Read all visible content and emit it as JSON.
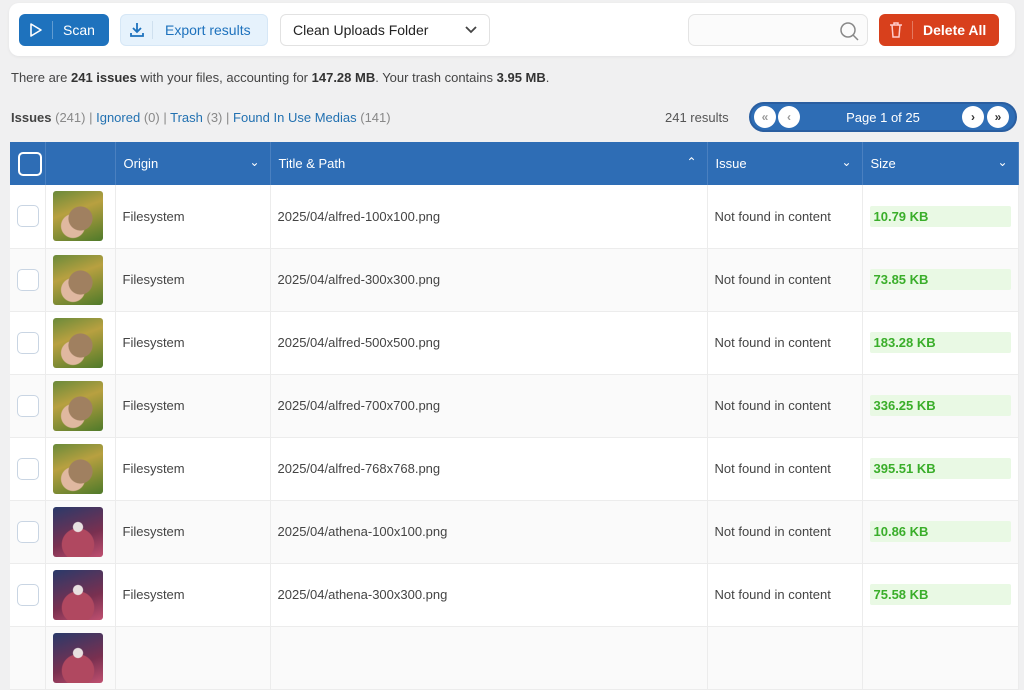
{
  "toolbar": {
    "scan": "Scan",
    "export": "Export results",
    "select": "Clean Uploads Folder",
    "search_placeholder": "",
    "delete_all": "Delete All"
  },
  "summary": {
    "pre": "There are ",
    "issues": "241 issues",
    "mid": " with your files, accounting for ",
    "size": "147.28 MB",
    "mid2": ". Your trash contains ",
    "trash": "3.95 MB",
    "end": "."
  },
  "tabs": {
    "issues": "Issues",
    "issues_count": "(241)",
    "ignored": "Ignored",
    "ignored_count": "(0)",
    "trash": "Trash",
    "trash_count": "(3)",
    "found": "Found In Use Medias",
    "found_count": "(141)",
    "sep": "|"
  },
  "pagination": {
    "results": "241 results",
    "page": "Page 1 of 25",
    "first": "«",
    "prev": "‹",
    "next": "›",
    "last": "»"
  },
  "columns": {
    "origin": "Origin",
    "title": "Title & Path",
    "issue": "Issue",
    "size": "Size"
  },
  "rows": [
    {
      "thumb": "alfred",
      "origin": "Filesystem",
      "path": "2025/04/alfred-100x100.png",
      "issue": "Not found in content",
      "size": "10.79 KB"
    },
    {
      "thumb": "alfred",
      "origin": "Filesystem",
      "path": "2025/04/alfred-300x300.png",
      "issue": "Not found in content",
      "size": "73.85 KB"
    },
    {
      "thumb": "alfred",
      "origin": "Filesystem",
      "path": "2025/04/alfred-500x500.png",
      "issue": "Not found in content",
      "size": "183.28 KB"
    },
    {
      "thumb": "alfred",
      "origin": "Filesystem",
      "path": "2025/04/alfred-700x700.png",
      "issue": "Not found in content",
      "size": "336.25 KB"
    },
    {
      "thumb": "alfred",
      "origin": "Filesystem",
      "path": "2025/04/alfred-768x768.png",
      "issue": "Not found in content",
      "size": "395.51 KB"
    },
    {
      "thumb": "athena",
      "origin": "Filesystem",
      "path": "2025/04/athena-100x100.png",
      "issue": "Not found in content",
      "size": "10.86 KB"
    },
    {
      "thumb": "athena",
      "origin": "Filesystem",
      "path": "2025/04/athena-300x300.png",
      "issue": "Not found in content",
      "size": "75.58 KB"
    }
  ]
}
